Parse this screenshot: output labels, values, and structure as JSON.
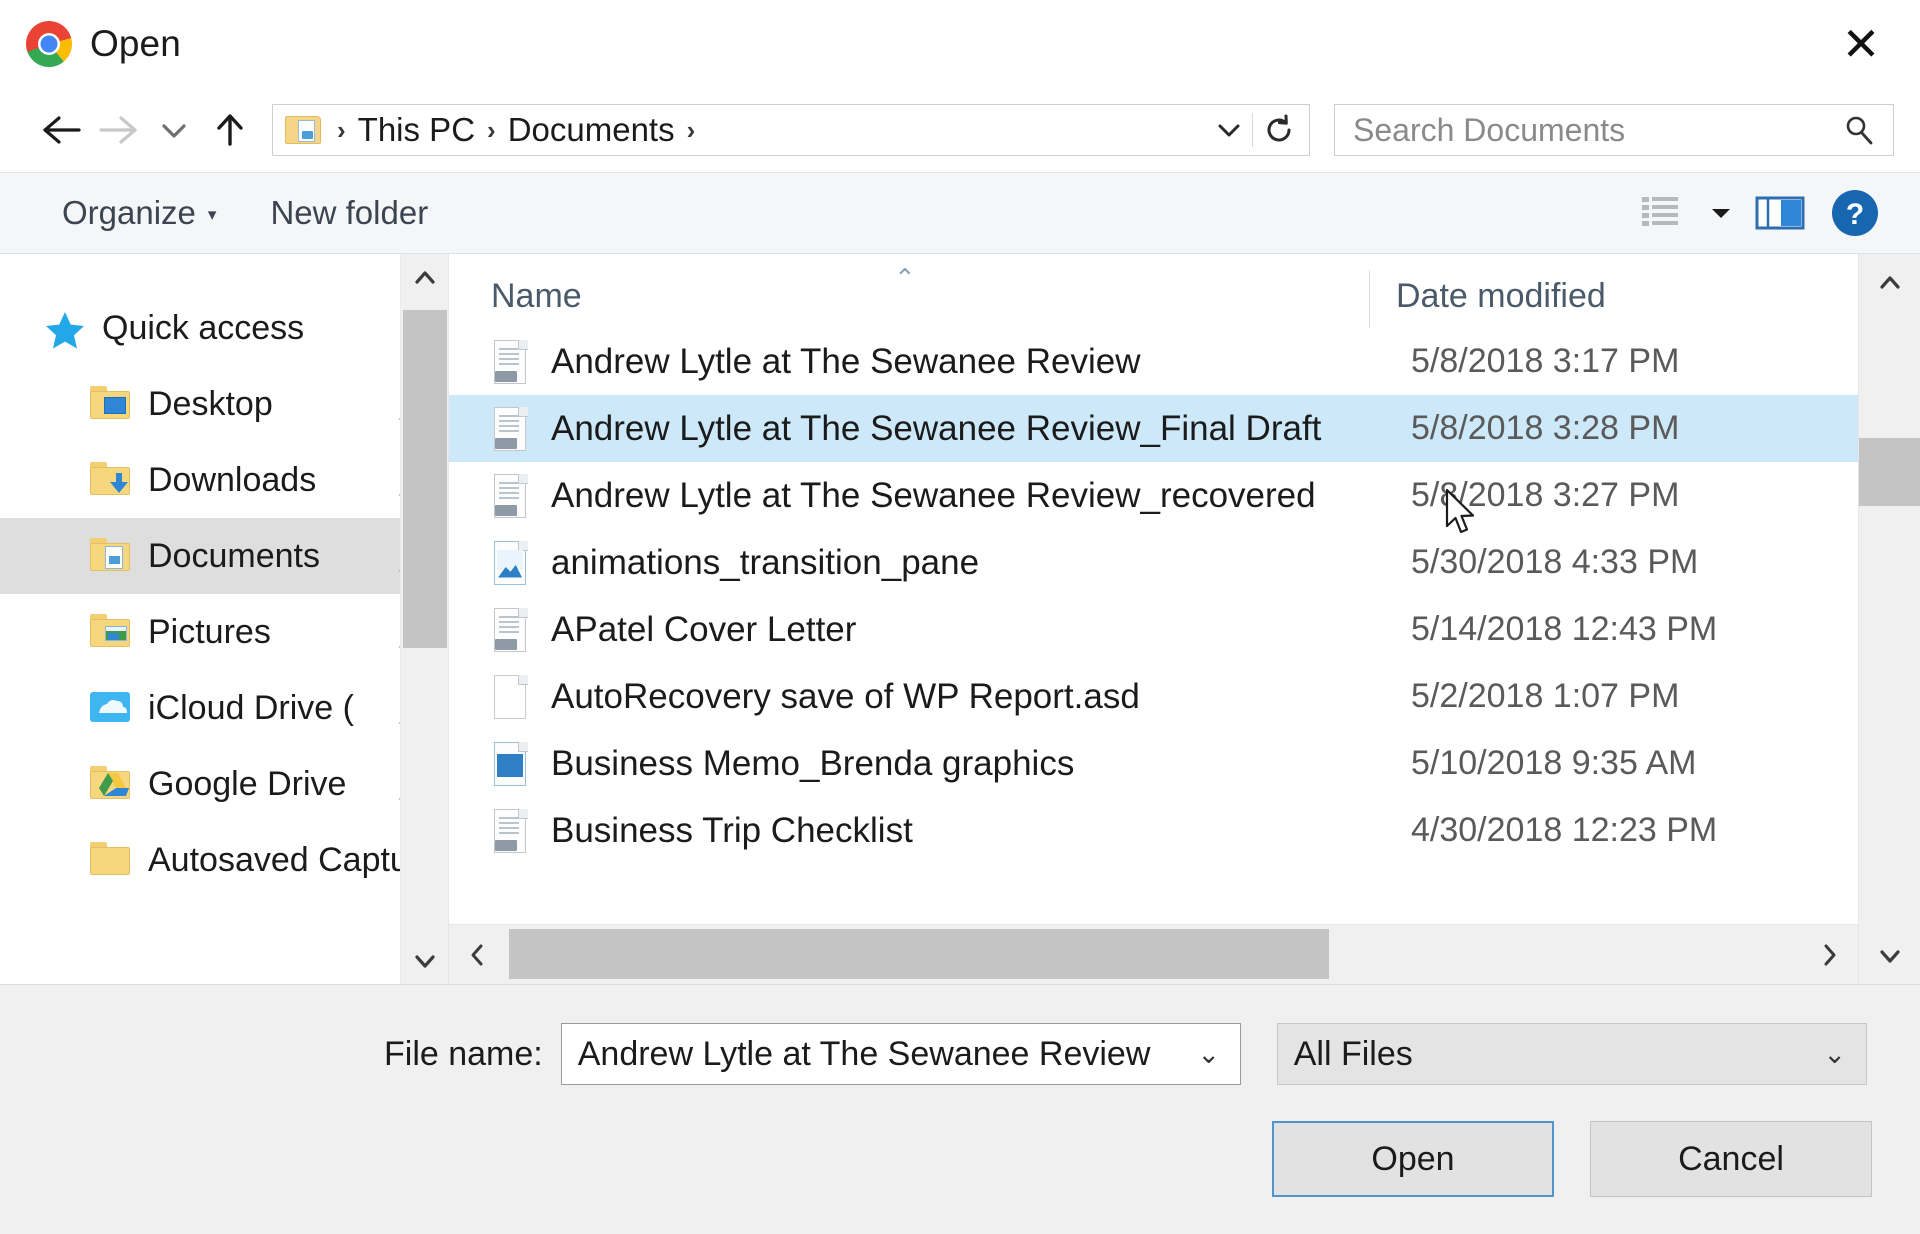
{
  "window": {
    "title": "Open",
    "app_icon": "chrome-logo",
    "close_label": "✕"
  },
  "nav": {
    "back_icon": "arrow-left-icon",
    "forward_icon": "arrow-right-icon",
    "recent_icon": "chevron-down-icon",
    "up_icon": "arrow-up-icon",
    "address_icon": "documents-folder-icon",
    "breadcrumbs": [
      "This PC",
      "Documents"
    ],
    "separator": "›",
    "dropdown_icon": "chevron-down-icon",
    "refresh_icon": "refresh-icon"
  },
  "search": {
    "placeholder": "Search Documents",
    "icon": "search-icon"
  },
  "toolbar": {
    "organize_label": "Organize",
    "organize_caret": "▾",
    "new_folder_label": "New folder",
    "view_icon": "list-view-icon",
    "view_caret": "▾",
    "preview_pane_icon": "preview-pane-icon",
    "help_icon": "help-icon",
    "help_glyph": "?"
  },
  "sidebar": {
    "items": [
      {
        "label": "Quick access",
        "icon": "star-icon",
        "indent": false,
        "pinned": false,
        "selected": false
      },
      {
        "label": "Desktop",
        "icon": "desktop-folder-icon",
        "indent": true,
        "pinned": true,
        "selected": false
      },
      {
        "label": "Downloads",
        "icon": "downloads-folder-icon",
        "indent": true,
        "pinned": true,
        "selected": false
      },
      {
        "label": "Documents",
        "icon": "documents-folder-icon",
        "indent": true,
        "pinned": true,
        "selected": true
      },
      {
        "label": "Pictures",
        "icon": "pictures-folder-icon",
        "indent": true,
        "pinned": true,
        "selected": false
      },
      {
        "label": "iCloud Drive (",
        "icon": "icloud-drive-icon",
        "indent": true,
        "pinned": true,
        "selected": false
      },
      {
        "label": "Google Drive",
        "icon": "google-drive-icon",
        "indent": true,
        "pinned": true,
        "selected": false
      },
      {
        "label": "Autosaved Captu",
        "icon": "plain-folder-icon",
        "indent": true,
        "pinned": false,
        "selected": false
      }
    ],
    "scroll_up_icon": "chevron-up-icon",
    "scroll_down_icon": "chevron-down-icon"
  },
  "filelist": {
    "columns": [
      "Name",
      "Date modified"
    ],
    "sort_indicator": "⌃",
    "rows": [
      {
        "name": "Andrew Lytle at The Sewanee Review",
        "date": "5/8/2018 3:17 PM",
        "icon": "word-doc-icon",
        "selected": false
      },
      {
        "name": "Andrew Lytle at The Sewanee Review_Final Draft",
        "date": "5/8/2018 3:28 PM",
        "icon": "word-doc-icon",
        "selected": true
      },
      {
        "name": "Andrew Lytle at The Sewanee Review_recovered",
        "date": "5/8/2018 3:27 PM",
        "icon": "word-doc-icon",
        "selected": false
      },
      {
        "name": "animations_transition_pane",
        "date": "5/30/2018 4:33 PM",
        "icon": "image-file-icon",
        "selected": false
      },
      {
        "name": "APatel Cover Letter",
        "date": "5/14/2018 12:43 PM",
        "icon": "word-doc-icon",
        "selected": false
      },
      {
        "name": "AutoRecovery save of WP Report.asd",
        "date": "5/2/2018 1:07 PM",
        "icon": "blank-file-icon",
        "selected": false
      },
      {
        "name": "Business Memo_Brenda graphics",
        "date": "5/10/2018 9:35 AM",
        "icon": "ppt-file-icon",
        "selected": false
      },
      {
        "name": "Business Trip Checklist",
        "date": "4/30/2018 12:23 PM",
        "icon": "word-doc-icon",
        "selected": false
      }
    ],
    "vscroll_up_icon": "chevron-up-icon",
    "vscroll_down_icon": "chevron-down-icon",
    "hscroll_left_icon": "chevron-left-icon",
    "hscroll_right_icon": "chevron-right-icon"
  },
  "footer": {
    "filename_label": "File name:",
    "filename_value": "Andrew Lytle at The Sewanee Review",
    "filename_caret": "⌄",
    "filetype_value": "All Files",
    "filetype_caret": "⌄",
    "open_label": "Open",
    "cancel_label": "Cancel"
  },
  "colors": {
    "selection": "#cde8f9",
    "sidebar_selection": "#dedede",
    "accent": "#4f95d1",
    "toolbar_bg": "#f4f6f8",
    "footer_bg": "#f0f0f0"
  }
}
